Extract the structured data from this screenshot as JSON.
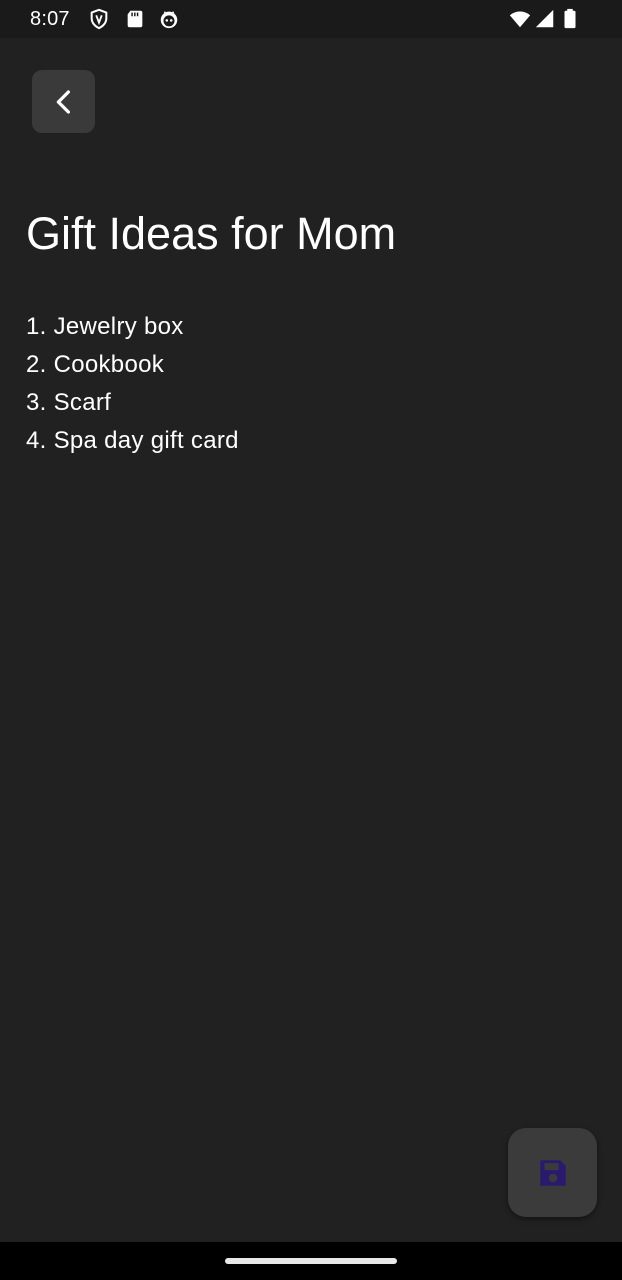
{
  "status_bar": {
    "time": "8:07",
    "left_icons": [
      "shield-icon",
      "sd-card-icon",
      "android-robot-icon"
    ],
    "right_icons": [
      "wifi-icon",
      "cellular-signal-icon",
      "battery-icon"
    ]
  },
  "toolbar": {
    "back_icon": "chevron-left-icon"
  },
  "note": {
    "title": "Gift Ideas for Mom",
    "lines": [
      "1. Jewelry box",
      "2. Cookbook",
      "3. Scarf",
      "4. Spa day gift card"
    ]
  },
  "fab": {
    "icon": "save-icon",
    "icon_color": "#2a1a6e"
  },
  "colors": {
    "background": "#212121",
    "status_bar": "#1a1a1a",
    "button_surface": "#3a3a3a",
    "text": "#ffffff",
    "nav_bar": "#000000"
  }
}
